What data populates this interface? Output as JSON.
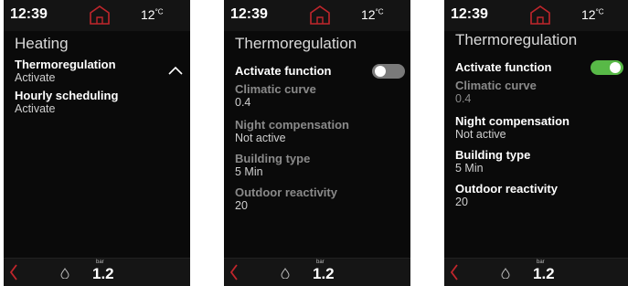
{
  "screens": [
    {
      "time": "12:39",
      "temp": "12",
      "temp_unit": "°C",
      "title": "Heating",
      "items": [
        {
          "label": "Thermoregulation",
          "value": "Activate"
        },
        {
          "label": "Hourly scheduling",
          "value": "Activate"
        }
      ],
      "bar_unit": "bar",
      "pressure": "1.2"
    },
    {
      "time": "12:39",
      "temp": "12",
      "temp_unit": "°C",
      "title": "Thermoregulation",
      "toggle_label": "Activate function",
      "toggle_on": false,
      "items": [
        {
          "label": "Climatic curve",
          "value": "0.4"
        },
        {
          "label": "Night compensation",
          "value": "Not active"
        },
        {
          "label": "Building type",
          "value": "5 Min"
        },
        {
          "label": "Outdoor reactivity",
          "value": "20"
        }
      ],
      "bar_unit": "bar",
      "pressure": "1.2"
    },
    {
      "time": "12:39",
      "temp": "12",
      "temp_unit": "°C",
      "title": "Thermoregulation",
      "toggle_label": "Activate function",
      "toggle_on": true,
      "items": [
        {
          "label": "Climatic curve",
          "value": "0.4"
        },
        {
          "label": "Night compensation",
          "value": "Not active"
        },
        {
          "label": "Building type",
          "value": "5 Min"
        },
        {
          "label": "Outdoor reactivity",
          "value": "20"
        }
      ],
      "bar_unit": "bar",
      "pressure": "1.2"
    }
  ],
  "colors": {
    "accent_red": "#c0262c",
    "toggle_off": "#7a7a7a",
    "toggle_on": "#58b947"
  },
  "icons": [
    "home-icon",
    "back-arrow-icon",
    "water-drop-icon",
    "chevron-up-icon"
  ]
}
